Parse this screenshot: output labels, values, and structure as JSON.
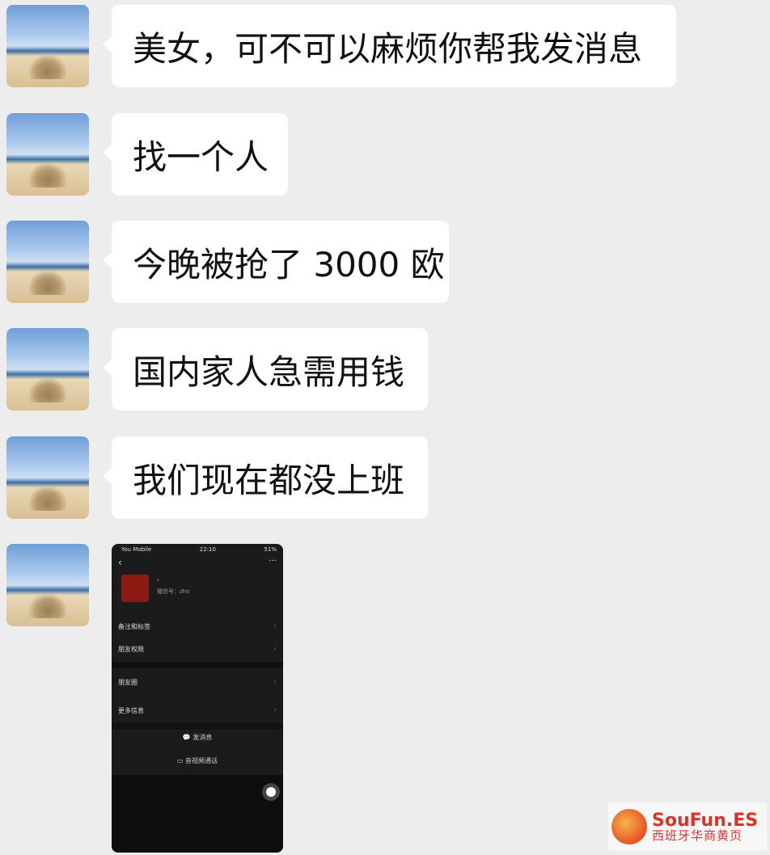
{
  "messages": [
    {
      "type": "text",
      "text": "美女，可不可以麻烦你帮我发消息"
    },
    {
      "type": "text",
      "text": "找一个人"
    },
    {
      "type": "text",
      "text": "今晚被抢了 3000 欧"
    },
    {
      "type": "text",
      "text": "国内家人急需用钱"
    },
    {
      "type": "text",
      "text": "我们现在都没上班"
    }
  ],
  "avatar_icon": "beach-sandcastle-avatar",
  "screenshot": {
    "carrier": "You Mobile",
    "time": "22:10",
    "battery": "51%",
    "back_icon": "‹",
    "more_icon": "···",
    "name": "-",
    "wechat_id": "微信号：zho",
    "rows": [
      "备注和标签",
      "朋友权限",
      "朋友圈",
      "更多信息"
    ],
    "actions": [
      "发消息",
      "音视频通话"
    ],
    "message_icon": "💬",
    "video_icon": "▭"
  },
  "watermark": {
    "line1": "SouFun.ES",
    "line2": "西班牙华商黄页"
  }
}
